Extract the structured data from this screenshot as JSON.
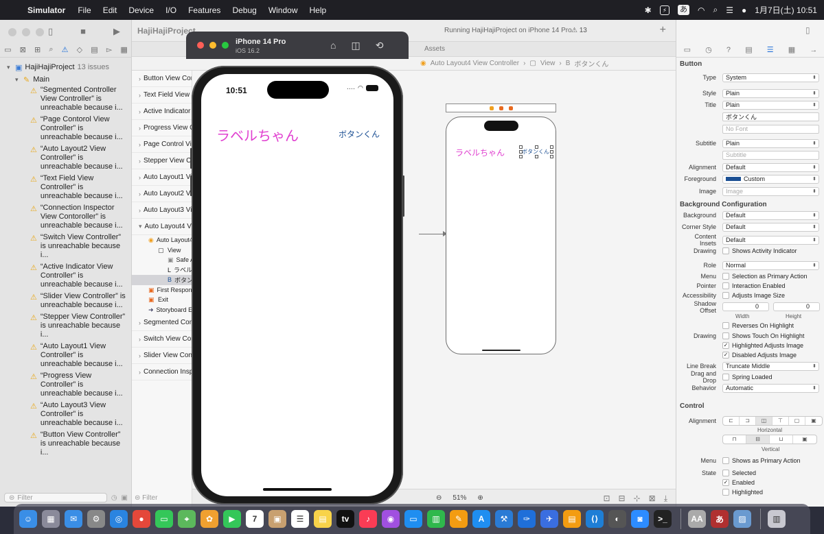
{
  "menubar": {
    "app_name": "Simulator",
    "menus": [
      "File",
      "Edit",
      "Device",
      "I/O",
      "Features",
      "Debug",
      "Window",
      "Help"
    ],
    "ime": "あ",
    "battery": "⚡",
    "clock": "1月7日(土)  10:51"
  },
  "navigator": {
    "project": "HajiHajiProject",
    "issues_count": "13 issues",
    "group": "Main",
    "issues": [
      "“Segmented Controller View Controller” is unreachable because i...",
      "“Page Contorol View Controller” is unreachable because i...",
      "“Auto Layout2 View Controller” is unreachable because i...",
      "“Text Field View Controller” is unreachable because i...",
      "“Connection Inspector View Contoroller” is unreachable because i...",
      "“Switch View Controller” is unreachable because i...",
      "“Active Indicator View Controller” is unreachable because i...",
      "“Slider View Controller” is unreachable because i...",
      "“Stepper View Controller” is unreachable because i...",
      "“Auto Layout1 View Controller” is unreachable because i...",
      "“Progress View Controller” is unreachable because i...",
      "“Auto Layout3 View Controller” is unreachable because i...",
      "“Button View Controller” is unreachable because i..."
    ],
    "filter_placeholder": "Filter"
  },
  "toolbar": {
    "project_title": "HajiHajiProject",
    "running_status": "Running HajiHajiProject on iPhone 14 Pro",
    "warning_count": "13",
    "assets_tab": "Assets"
  },
  "breadcrumb": {
    "controller": "Auto Layout4 View Controller",
    "view": "View",
    "button": "ボタンくん"
  },
  "outline": {
    "scenes": [
      "Button View Controller Scene",
      "Text Field View Controller Scene",
      "Active Indicator View Controller Scene",
      "Progress View Controller Scene",
      "Page Control View Controller Scene",
      "Stepper View Controller Scene",
      "Auto Layout1 View Controller Scene",
      "Auto Layout2 View Controller Scene",
      "Auto Layout3 View Controller Scene",
      "Auto Layout4 View Controller Scene"
    ],
    "expanded": {
      "controller": "Auto Layout4 View Controller",
      "view": "View",
      "safe_area": "Safe Area",
      "label": "ラベルちゃん",
      "button": "ボタンくん",
      "first_responder": "First Responder",
      "exit": "Exit",
      "storyboard_entry": "Storyboard Entry Point"
    },
    "more_scenes": [
      "Segmented Controller View Controller Scene",
      "Switch View Controller Scene",
      "Slider View Controller Scene",
      "Connection Inspector View Controller Scene"
    ],
    "filter_placeholder": "Filter"
  },
  "canvas": {
    "label_text": "ラベルちゃん",
    "button_text": "ボタンくん",
    "zoom": "51%"
  },
  "simulator": {
    "device": "iPhone 14 Pro",
    "os": "iOS 16.2",
    "time": "10:51",
    "label_text": "ラベルちゃん",
    "button_text": "ボタンくん"
  },
  "inspector": {
    "section_button": "Button",
    "type": "System",
    "style": "Plain",
    "title": "Plain",
    "title_text": "ボタンくん",
    "font_placeholder": "No Font",
    "subtitle": "Plain",
    "subtitle_placeholder": "Subtitle",
    "alignment": "Default",
    "foreground": "Custom",
    "image_placeholder": "Image",
    "section_background": "Background Configuration",
    "background": "Default",
    "corner_style": "Default",
    "content_insets": "Default",
    "drawing_check": "Shows Activity Indicator",
    "role": "Normal",
    "menu_check": "Selection as Primary Action",
    "pointer_check": "Interaction Enabled",
    "accessibility_check": "Adjusts Image Size",
    "shadow_width": "0",
    "shadow_height": "0",
    "width_label": "Width",
    "height_label": "Height",
    "reverses": "Reverses On Highlight",
    "shows_touch": "Shows Touch On Highlight",
    "highlighted_adjusts": "Highlighted Adjusts Image",
    "disabled_adjusts": "Disabled Adjusts Image",
    "line_break": "Truncate Middle",
    "drag_drop": "Spring Loaded",
    "behavior": "Automatic",
    "section_control": "Control",
    "horizontal_label": "Horizontal",
    "vertical_label": "Vertical",
    "control_menu": "Shows as Primary Action",
    "state_selected": "Selected",
    "state_enabled": "Enabled",
    "state_highlighted": "Highlighted",
    "labels": {
      "type": "Type",
      "style": "Style",
      "title": "Title",
      "subtitle": "Subtitle",
      "alignment": "Alignment",
      "foreground": "Foreground",
      "image": "Image",
      "background": "Background",
      "corner_style": "Corner Style",
      "content_insets": "Content Insets",
      "drawing": "Drawing",
      "role": "Role",
      "menu": "Menu",
      "pointer": "Pointer",
      "accessibility": "Accessibility",
      "shadow_offset": "Shadow Offset",
      "drawing2": "Drawing",
      "line_break": "Line Break",
      "drag_drop": "Drag and Drop",
      "behavior": "Behavior",
      "control_alignment": "Alignment",
      "control_menu": "Menu",
      "state": "State"
    }
  },
  "colors": {
    "label_magenta": "#e040d0",
    "button_blue": "#1b4f93",
    "warning": "#e8a81a"
  }
}
